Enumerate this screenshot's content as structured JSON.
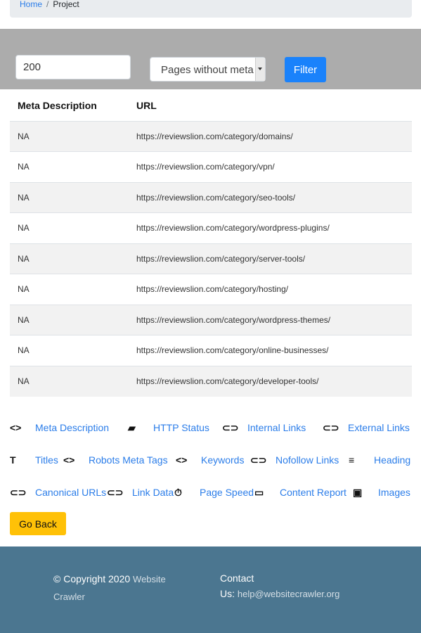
{
  "breadcrumb": {
    "home": "Home",
    "separator": "/",
    "current": "Project"
  },
  "filter": {
    "limit_value": "200",
    "type_selected": "Pages without meta",
    "filter_label": "Filter"
  },
  "table": {
    "headers": [
      "Meta Description",
      "URL"
    ],
    "rows": [
      [
        "NA",
        "https://reviewslion.com/category/domains/"
      ],
      [
        "NA",
        "https://reviewslion.com/category/vpn/"
      ],
      [
        "NA",
        "https://reviewslion.com/category/seo-tools/"
      ],
      [
        "NA",
        "https://reviewslion.com/category/wordpress-plugins/"
      ],
      [
        "NA",
        "https://reviewslion.com/category/server-tools/"
      ],
      [
        "NA",
        "https://reviewslion.com/category/hosting/"
      ],
      [
        "NA",
        "https://reviewslion.com/category/wordpress-themes/"
      ],
      [
        "NA",
        "https://reviewslion.com/category/online-businesses/"
      ],
      [
        "NA",
        "https://reviewslion.com/category/developer-tools/"
      ]
    ]
  },
  "nav_links": [
    {
      "icon": "code-icon",
      "label": "Meta Description"
    },
    {
      "icon": "chart-icon",
      "label": "HTTP Status"
    },
    {
      "icon": "link-icon",
      "label": "Internal Links"
    },
    {
      "icon": "link-icon",
      "label": "External Links"
    },
    {
      "icon": "text-icon",
      "label": "Titles"
    },
    {
      "icon": "code-icon",
      "label": "Robots Meta Tags"
    },
    {
      "icon": "code-icon",
      "label": "Keywords"
    },
    {
      "icon": "link-icon",
      "label": "Nofollow Links"
    },
    {
      "icon": "list-icon",
      "label": "Heading"
    },
    {
      "icon": "link-icon",
      "label": "Canonical URLs"
    },
    {
      "icon": "link-icon",
      "label": "Link Data"
    },
    {
      "icon": "timer-icon",
      "label": "Page Speed"
    },
    {
      "icon": "clipboard-icon",
      "label": "Content Report"
    },
    {
      "icon": "image-icon",
      "label": "Images"
    }
  ],
  "back_label": "Go Back",
  "footer": {
    "copyright": "© Copyright 2020",
    "brand": "Website Crawler",
    "contact_label": "Contact",
    "us_label": "Us:",
    "email": "help@websitecrawler.org"
  },
  "colors": {
    "primary": "#1a82fb",
    "link": "#2b7de9",
    "warning": "#ffc107",
    "footer": "#4b7690",
    "filter_bar": "#acacac"
  }
}
